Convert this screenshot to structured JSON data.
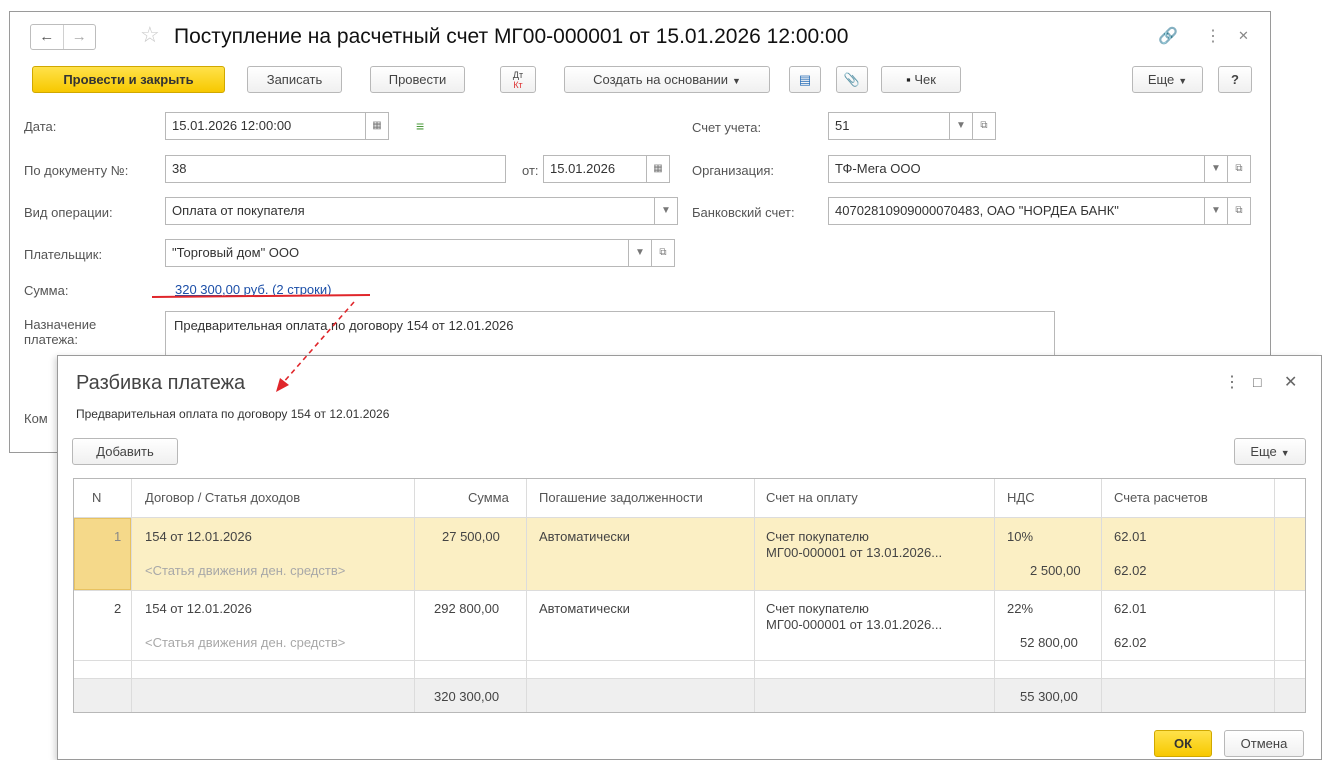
{
  "main": {
    "title": "Поступление на расчетный счет МГ00-000001 от 15.01.2026 12:00:00",
    "toolbar": {
      "post_close": "Провести и закрыть",
      "save": "Записать",
      "post": "Провести",
      "dt_kt": "Дт Кт",
      "create_based": "Создать на основании",
      "check": "Чек",
      "more": "Еще",
      "help": "?"
    },
    "fields": {
      "date_label": "Дата:",
      "date_value": "15.01.2026 12:00:00",
      "doc_no_label": "По документу №:",
      "doc_no_value": "38",
      "from_label": "от:",
      "from_value": "15.01.2026",
      "op_label": "Вид операции:",
      "op_value": "Оплата от покупателя",
      "payer_label": "Плательщик:",
      "payer_value": "\"Торговый дом\" ООО",
      "sum_label": "Сумма:",
      "sum_link": "320 300,00 руб. (2 строки)",
      "purpose_label": "Назначение платежа:",
      "purpose_value": "Предварительная оплата по договору 154 от 12.01.2026",
      "comment_label": "Ком",
      "account_label": "Счет учета:",
      "account_value": "51",
      "org_label": "Организация:",
      "org_value": "ТФ-Мега ООО",
      "bank_label": "Банковский счет:",
      "bank_value": "40702810909000070483, ОАО \"НОРДЕА БАНК\""
    }
  },
  "dialog": {
    "title": "Разбивка платежа",
    "subtitle": "Предварительная оплата по договору 154 от 12.01.2026",
    "add": "Добавить",
    "more": "Еще",
    "ok": "ОК",
    "cancel": "Отмена",
    "columns": [
      "N",
      "Договор / Статья доходов",
      "Сумма",
      "Погашение задолженности",
      "Счет на оплату",
      "НДС",
      "Счета расчетов"
    ],
    "rows": [
      {
        "n": "1",
        "contract": "154 от 12.01.2026",
        "article": "<Статья движения ден. средств>",
        "sum": "27 500,00",
        "repay": "Автоматически",
        "invoice_1": "Счет покупателю",
        "invoice_2": "МГ00-000001 от 13.01.2026...",
        "vat_rate": "10%",
        "vat_sum": "2 500,00",
        "acc_1": "62.01",
        "acc_2": "62.02"
      },
      {
        "n": "2",
        "contract": "154 от 12.01.2026",
        "article": "<Статья движения ден. средств>",
        "sum": "292 800,00",
        "repay": "Автоматически",
        "invoice_1": "Счет покупателю",
        "invoice_2": "МГ00-000001 от 13.01.2026...",
        "vat_rate": "22%",
        "vat_sum": "52 800,00",
        "acc_1": "62.01",
        "acc_2": "62.02"
      }
    ],
    "totals": {
      "sum": "320 300,00",
      "vat": "55 300,00"
    }
  },
  "colors": {
    "accent_yellow": "#f7c800",
    "selected_row": "#fbefc4",
    "link_blue": "#1c4fa8",
    "annotation_red": "#e0262b"
  }
}
